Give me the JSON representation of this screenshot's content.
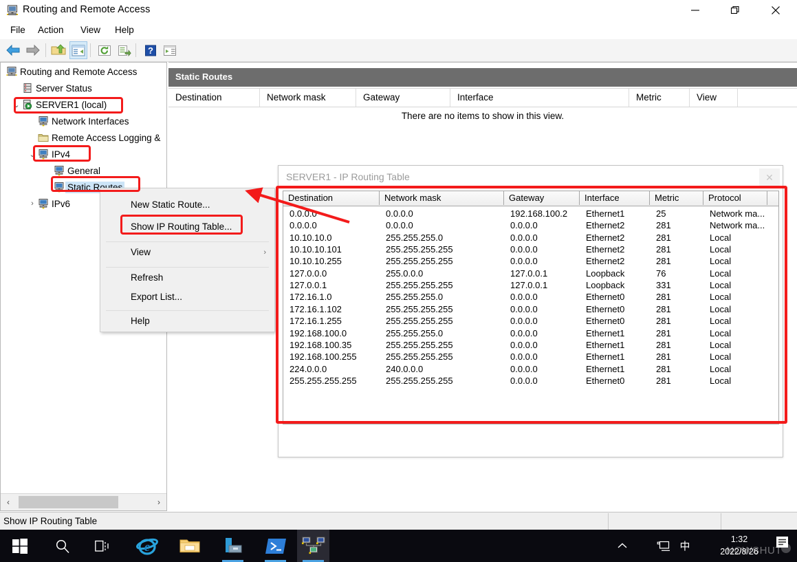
{
  "window": {
    "title": "Routing and Remote Access",
    "icon": "computer-icon",
    "controls": {
      "minimize": "–",
      "maximize": "❐",
      "close": "✕"
    }
  },
  "menubar": {
    "items": [
      "File",
      "Action",
      "View",
      "Help"
    ]
  },
  "toolbar": {
    "buttons": [
      {
        "name": "back-icon",
        "glyph": "back"
      },
      {
        "name": "forward-icon",
        "glyph": "forward"
      },
      {
        "name": "up-folder-icon",
        "glyph": "upfolder"
      },
      {
        "name": "show-hide-console-tree-icon",
        "glyph": "console-tree",
        "selected": true
      },
      {
        "name": "refresh-icon",
        "glyph": "refresh"
      },
      {
        "name": "export-list-icon",
        "glyph": "export"
      },
      {
        "name": "help-icon",
        "glyph": "help"
      },
      {
        "name": "show-hide-action-pane-icon",
        "glyph": "action-pane"
      }
    ]
  },
  "tree": {
    "items": [
      {
        "label": "Routing and Remote Access",
        "icon": "server-icon",
        "indent": 0,
        "twisty": "",
        "selected": false,
        "highlight": false
      },
      {
        "label": "Server Status",
        "icon": "status-icon",
        "indent": 1,
        "twisty": "",
        "selected": false,
        "highlight": false
      },
      {
        "label": "SERVER1 (local)",
        "icon": "server-up-icon",
        "indent": 1,
        "twisty": "v",
        "selected": false,
        "highlight": true
      },
      {
        "label": "Network Interfaces",
        "icon": "computer-icon",
        "indent": 2,
        "twisty": "",
        "selected": false,
        "highlight": false
      },
      {
        "label": "Remote Access Logging &",
        "icon": "folder-icon",
        "indent": 2,
        "twisty": "",
        "selected": false,
        "highlight": false
      },
      {
        "label": "IPv4",
        "icon": "computer-icon",
        "indent": 2,
        "twisty": "v",
        "selected": false,
        "highlight": true
      },
      {
        "label": "General",
        "icon": "computer-icon",
        "indent": 3,
        "twisty": "",
        "selected": false,
        "highlight": false
      },
      {
        "label": "Static Routes",
        "icon": "computer-icon",
        "indent": 3,
        "twisty": "",
        "selected": true,
        "highlight": true
      },
      {
        "label": "IPv6",
        "icon": "computer-icon",
        "indent": 2,
        "twisty": ">",
        "selected": false,
        "highlight": false
      }
    ],
    "hscroll": {
      "left_arrow": "‹",
      "right_arrow": "›"
    }
  },
  "content": {
    "header": "Static Routes",
    "columns": [
      "Destination",
      "Network mask",
      "Gateway",
      "Interface",
      "Metric",
      "View"
    ],
    "empty_message": "There are no items to show in this view."
  },
  "context_menu": {
    "items": [
      {
        "label": "New Static Route...",
        "submenu": false,
        "highlight": false
      },
      {
        "label": "Show IP Routing Table...",
        "submenu": false,
        "highlight": true
      },
      {
        "label": "View",
        "submenu": true,
        "highlight": false,
        "submenu_glyph": "›"
      },
      {
        "label": "Refresh",
        "submenu": false,
        "highlight": false
      },
      {
        "label": "Export List...",
        "submenu": false,
        "highlight": false
      },
      {
        "label": "Help",
        "submenu": false,
        "highlight": false
      }
    ]
  },
  "routing_table": {
    "title": "SERVER1 - IP Routing Table",
    "close_glyph": "✕",
    "columns": [
      "Destination",
      "Network mask",
      "Gateway",
      "Interface",
      "Metric",
      "Protocol"
    ],
    "rows": [
      [
        "0.0.0.0",
        "0.0.0.0",
        "192.168.100.2",
        "Ethernet1",
        "25",
        "Network ma..."
      ],
      [
        "0.0.0.0",
        "0.0.0.0",
        "0.0.0.0",
        "Ethernet2",
        "281",
        "Network ma..."
      ],
      [
        "10.10.10.0",
        "255.255.255.0",
        "0.0.0.0",
        "Ethernet2",
        "281",
        "Local"
      ],
      [
        "10.10.10.101",
        "255.255.255.255",
        "0.0.0.0",
        "Ethernet2",
        "281",
        "Local"
      ],
      [
        "10.10.10.255",
        "255.255.255.255",
        "0.0.0.0",
        "Ethernet2",
        "281",
        "Local"
      ],
      [
        "127.0.0.0",
        "255.0.0.0",
        "127.0.0.1",
        "Loopback",
        "76",
        "Local"
      ],
      [
        "127.0.0.1",
        "255.255.255.255",
        "127.0.0.1",
        "Loopback",
        "331",
        "Local"
      ],
      [
        "172.16.1.0",
        "255.255.255.0",
        "0.0.0.0",
        "Ethernet0",
        "281",
        "Local"
      ],
      [
        "172.16.1.102",
        "255.255.255.255",
        "0.0.0.0",
        "Ethernet0",
        "281",
        "Local"
      ],
      [
        "172.16.1.255",
        "255.255.255.255",
        "0.0.0.0",
        "Ethernet0",
        "281",
        "Local"
      ],
      [
        "192.168.100.0",
        "255.255.255.0",
        "0.0.0.0",
        "Ethernet1",
        "281",
        "Local"
      ],
      [
        "192.168.100.35",
        "255.255.255.255",
        "0.0.0.0",
        "Ethernet1",
        "281",
        "Local"
      ],
      [
        "192.168.100.255",
        "255.255.255.255",
        "0.0.0.0",
        "Ethernet1",
        "281",
        "Local"
      ],
      [
        "224.0.0.0",
        "240.0.0.0",
        "0.0.0.0",
        "Ethernet1",
        "281",
        "Local"
      ],
      [
        "255.255.255.255",
        "255.255.255.255",
        "0.0.0.0",
        "Ethernet0",
        "281",
        "Local"
      ]
    ]
  },
  "statusbar": {
    "text": "Show IP Routing Table"
  },
  "taskbar": {
    "items": [
      {
        "name": "start-button-icon",
        "running": false
      },
      {
        "name": "search-icon",
        "running": false
      },
      {
        "name": "task-view-icon",
        "running": false
      },
      {
        "name": "internet-explorer-icon",
        "running": false
      },
      {
        "name": "file-explorer-icon",
        "running": false
      },
      {
        "name": "server-manager-icon",
        "running": true
      },
      {
        "name": "powershell-icon",
        "running": true
      },
      {
        "name": "routing-remote-access-icon",
        "running": true,
        "active": true
      }
    ],
    "tray": {
      "chevron": "^",
      "network_icon": "network-icon",
      "ime_indicator": "中",
      "time": "1:32",
      "date": "2022/8/26",
      "watermark": "NOWSHUT",
      "notification_icon": "notification-icon"
    }
  },
  "colors": {
    "accent": "#f31b1b",
    "header_bg": "#6d6d6d",
    "selection": "#cce4f7"
  }
}
